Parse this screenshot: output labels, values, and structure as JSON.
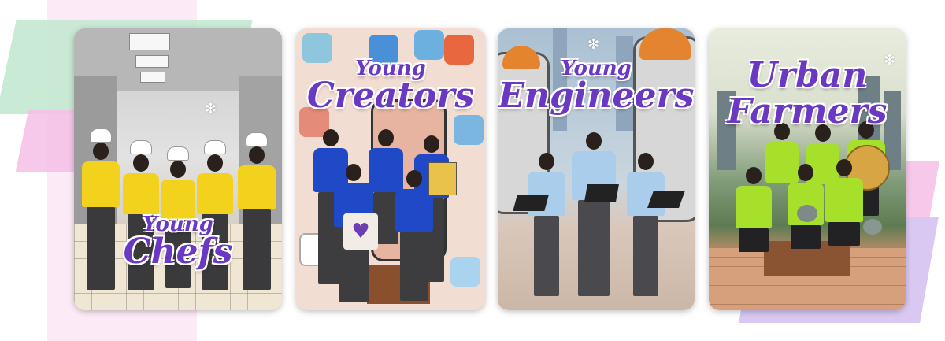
{
  "cards": [
    {
      "title_line1": "Young",
      "title_line2": "Chefs",
      "theme": "kitchen",
      "shirt_color": "#f3d21d",
      "pants_color": "#3a3a3c"
    },
    {
      "title_line1": "Young",
      "title_line2": "Creators",
      "theme": "social-media",
      "shirt_color": "#1f49c6",
      "pants_color": "#3d3d40"
    },
    {
      "title_line1": "Young",
      "title_line2": "Engineers",
      "theme": "robots",
      "shirt_color": "#a9cdeb",
      "pants_color": "#4a4a4e"
    },
    {
      "title_line1": "Urban",
      "title_line2": "Farmers",
      "theme": "rooftop-garden",
      "shirt_color": "#a7e02a",
      "pants_color": "#222224"
    }
  ],
  "colors": {
    "title": "#6a38c2",
    "accent_green": "#bfe8cf",
    "accent_pink": "#f5bfe6",
    "accent_lavender": "#d8c8f2"
  },
  "icons": [
    "sparkle-icon",
    "chef-hat-icon",
    "laptop-icon",
    "book-icon",
    "heart-tote-icon",
    "melon-icon"
  ]
}
